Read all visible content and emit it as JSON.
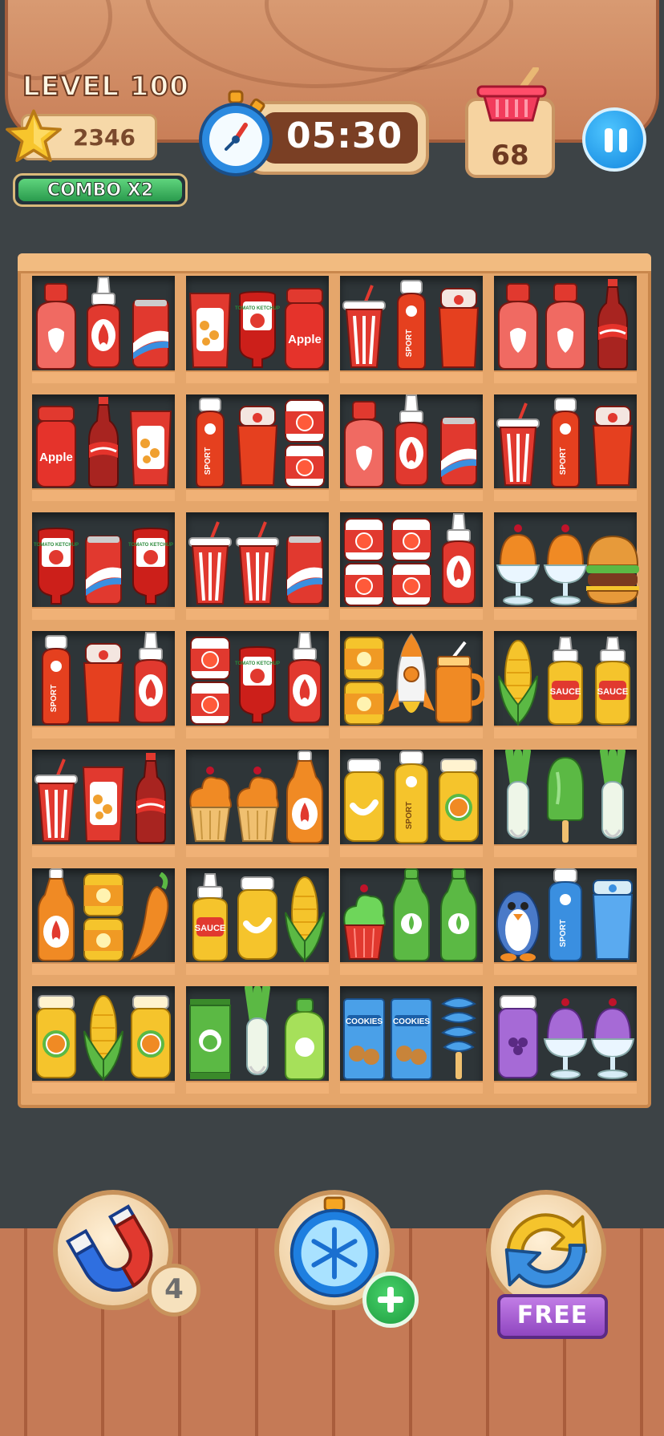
{
  "hud": {
    "level_label": "LEVEL 100",
    "star_count": "2346",
    "combo_label": "COMBO X2",
    "timer": "05:30",
    "basket_count": "68"
  },
  "colors": {
    "red": "#e1392f",
    "orange": "#f08a24",
    "yellow": "#f5c42c",
    "green": "#5bb944",
    "blue": "#3a8fe0",
    "purple": "#a66ad6"
  },
  "shelf": [
    [
      [
        "milk-red",
        "ketchup-fire",
        "can-red"
      ],
      [
        "chips-red",
        "ketchup-tomato",
        "apple-jar"
      ],
      [
        "cup-red",
        "sport-bottle-red",
        "thermos-red"
      ],
      [
        "milk-red",
        "milk-red",
        "cola-bottle"
      ]
    ],
    [
      [
        "apple-jar",
        "cola-bottle",
        "chips-red"
      ],
      [
        "sport-bottle-red",
        "thermos-red",
        "tomato-can-stack"
      ],
      [
        "milk-red",
        "ketchup-fire",
        "can-red"
      ],
      [
        "cup-red",
        "sport-bottle-red",
        "thermos-red"
      ]
    ],
    [
      [
        "ketchup-tomato",
        "can-red",
        "ketchup-tomato"
      ],
      [
        "cup-red",
        "cup-red",
        "can-red"
      ],
      [
        "tomato-can-stack",
        "tomato-can-stack",
        "ketchup-fire"
      ],
      [
        "sundae-orange",
        "sundae-orange",
        "burger"
      ]
    ],
    [
      [
        "sport-bottle-red",
        "thermos-red",
        "ketchup-fire"
      ],
      [
        "tomato-can-stack",
        "ketchup-tomato",
        "ketchup-fire"
      ],
      [
        "honey-can-stack",
        "rocket-toy",
        "mug-orange"
      ],
      [
        "corn",
        "sauce-bottle",
        "sauce-bottle"
      ]
    ],
    [
      [
        "cup-red",
        "chips-red",
        "cola-bottle"
      ],
      [
        "cupcake-orange",
        "cupcake-orange",
        "juice-orange"
      ],
      [
        "banana-jar",
        "sport-bottle-yellow",
        "orange-jar"
      ],
      [
        "leek",
        "popsicle-green",
        "leek"
      ]
    ],
    [
      [
        "juice-orange",
        "honey-can-stack",
        "chili"
      ],
      [
        "sauce-bottle",
        "banana-jar",
        "corn"
      ],
      [
        "cupcake-green",
        "water-bottle-green",
        "water-bottle-green"
      ],
      [
        "penguin-toy",
        "sport-bottle-blue",
        "blue-cup"
      ]
    ],
    [
      [
        "orange-jar",
        "corn",
        "orange-jar"
      ],
      [
        "apple-snack",
        "leek",
        "apple-bottle"
      ],
      [
        "cookies-box",
        "cookies-box",
        "popsicle-blue"
      ],
      [
        "grape-jar",
        "sundae-purple",
        "sundae-purple"
      ]
    ]
  ],
  "texts": {
    "apple": "Apple",
    "sport": "SPORT",
    "sauce": "SAUCE",
    "ketchup": "TOMATO KETCHUP",
    "cookies": "COOKIES"
  },
  "boosters": {
    "magnet_count": "4",
    "shuffle_label": "FREE"
  }
}
